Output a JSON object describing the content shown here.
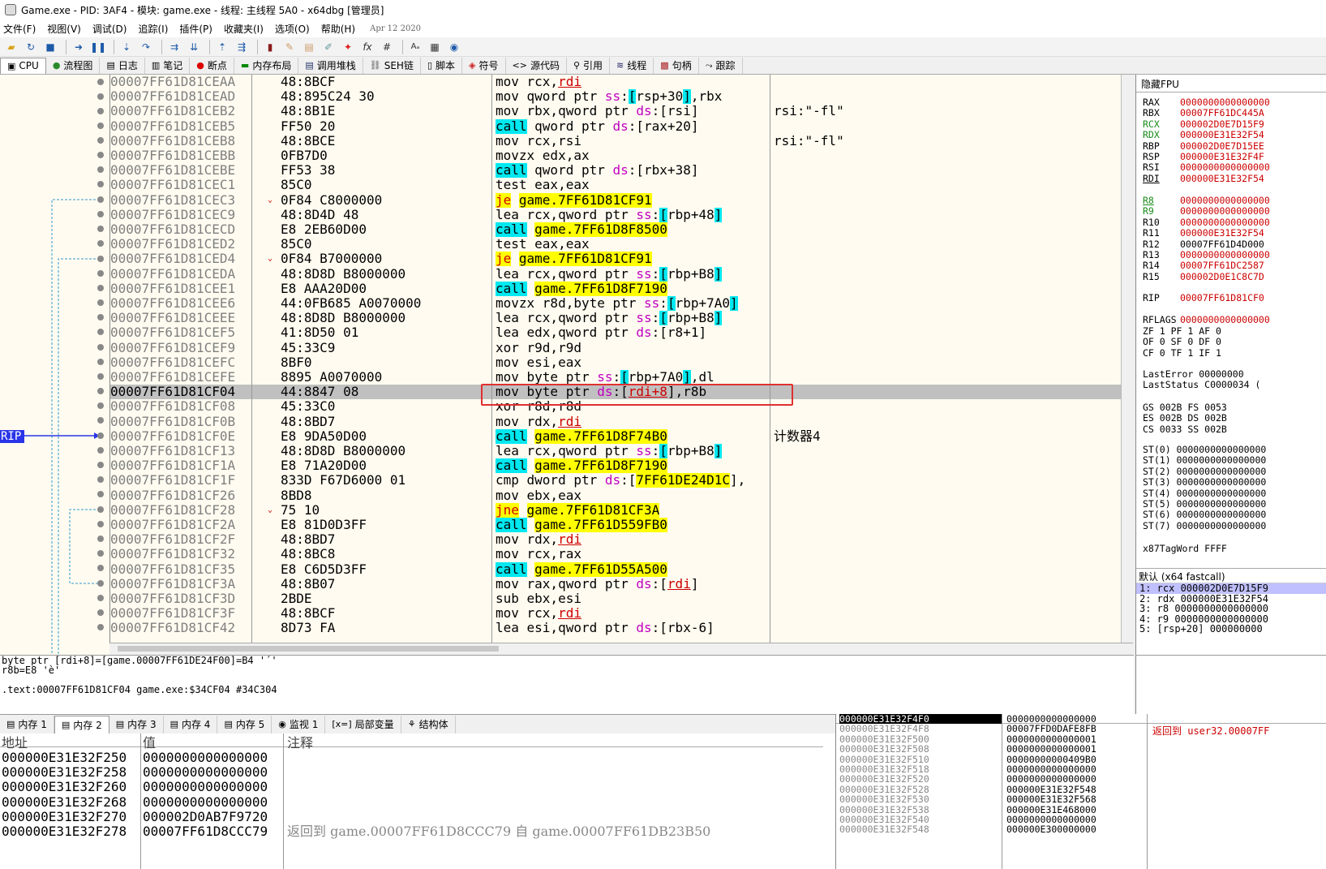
{
  "window": {
    "title": "Game.exe - PID: 3AF4 - 模块: game.exe - 线程: 主线程 5A0 - x64dbg [管理员]"
  },
  "menu": {
    "items": [
      "文件(F)",
      "视图(V)",
      "调试(D)",
      "追踪(I)",
      "插件(P)",
      "收藏夹(I)",
      "选项(O)",
      "帮助(H)"
    ],
    "date": "Apr 12 2020"
  },
  "toolbar": {
    "icons": [
      "open-icon",
      "restart-icon",
      "stop-icon",
      "run-icon",
      "pause-icon",
      "step-into-icon",
      "step-over-icon",
      "trace-into-icon",
      "trace-over-icon",
      "execute-till-return-icon",
      "run-to-user-code-icon",
      "patch-icon",
      "comment-icon",
      "label-icon",
      "bookmark-icon",
      "function-icon",
      "hash-icon",
      "font-icon",
      "calculator-icon",
      "module-icon",
      "globe-icon"
    ]
  },
  "tabs": [
    {
      "label": "CPU",
      "icon": "cpu-icon"
    },
    {
      "label": "流程图",
      "icon": "graph-icon"
    },
    {
      "label": "日志",
      "icon": "log-icon"
    },
    {
      "label": "笔记",
      "icon": "notes-icon"
    },
    {
      "label": "断点",
      "icon": "breakpoint-icon"
    },
    {
      "label": "内存布局",
      "icon": "memory-map-icon"
    },
    {
      "label": "调用堆栈",
      "icon": "callstack-icon"
    },
    {
      "label": "SEH链",
      "icon": "seh-icon"
    },
    {
      "label": "脚本",
      "icon": "script-icon"
    },
    {
      "label": "符号",
      "icon": "symbol-icon"
    },
    {
      "label": "源代码",
      "icon": "source-icon"
    },
    {
      "label": "引用",
      "icon": "references-icon"
    },
    {
      "label": "线程",
      "icon": "threads-icon"
    },
    {
      "label": "句柄",
      "icon": "handles-icon"
    },
    {
      "label": "跟踪",
      "icon": "trace-icon"
    }
  ],
  "rip_label": "RIP",
  "disasm": [
    {
      "addr": "00007FF61D81CEAA",
      "bytes": "48:8BCF",
      "i": [
        [
          "t",
          "mov rcx,"
        ],
        [
          "r",
          "rdi"
        ]
      ],
      "cmt": ""
    },
    {
      "addr": "00007FF61D81CEAD",
      "bytes": "48:895C24 30",
      "i": [
        [
          "t",
          "mov qword ptr "
        ],
        [
          "s",
          "ss"
        ],
        [
          "t",
          ":"
        ],
        [
          "b",
          "["
        ],
        [
          "t",
          "rsp+30"
        ],
        [
          "b",
          "]"
        ],
        [
          "t",
          ",rbx"
        ]
      ],
      "cmt": ""
    },
    {
      "addr": "00007FF61D81CEB2",
      "bytes": "48:8B1E",
      "i": [
        [
          "t",
          "mov rbx,qword ptr "
        ],
        [
          "s",
          "ds"
        ],
        [
          "t",
          ":[rsi]"
        ]
      ],
      "cmt": "rsi:\"-fl\""
    },
    {
      "addr": "00007FF61D81CEB5",
      "bytes": "FF50 20",
      "i": [
        [
          "c",
          "call"
        ],
        [
          "t",
          " qword ptr "
        ],
        [
          "s",
          "ds"
        ],
        [
          "t",
          ":[rax+20]"
        ]
      ],
      "cmt": ""
    },
    {
      "addr": "00007FF61D81CEB8",
      "bytes": "48:8BCE",
      "i": [
        [
          "t",
          "mov rcx,rsi"
        ]
      ],
      "cmt": "rsi:\"-fl\""
    },
    {
      "addr": "00007FF61D81CEBB",
      "bytes": "0FB7D0",
      "i": [
        [
          "t",
          "movzx edx,ax"
        ]
      ],
      "cmt": ""
    },
    {
      "addr": "00007FF61D81CEBE",
      "bytes": "FF53 38",
      "i": [
        [
          "c",
          "call"
        ],
        [
          "t",
          " qword ptr "
        ],
        [
          "s",
          "ds"
        ],
        [
          "t",
          ":[rbx+38]"
        ]
      ],
      "cmt": ""
    },
    {
      "addr": "00007FF61D81CEC1",
      "bytes": "85C0",
      "i": [
        [
          "t",
          "test eax,eax"
        ]
      ],
      "cmt": ""
    },
    {
      "addr": "00007FF61D81CEC3",
      "bytes": "0F84 C8000000",
      "arrow": true,
      "i": [
        [
          "j",
          "je"
        ],
        [
          "t",
          " "
        ],
        [
          "y",
          "game.7FF61D81CF91"
        ]
      ],
      "cmt": ""
    },
    {
      "addr": "00007FF61D81CEC9",
      "bytes": "48:8D4D 48",
      "i": [
        [
          "t",
          "lea rcx,qword ptr "
        ],
        [
          "s",
          "ss"
        ],
        [
          "t",
          ":"
        ],
        [
          "b",
          "["
        ],
        [
          "t",
          "rbp+48"
        ],
        [
          "b",
          "]"
        ]
      ],
      "cmt": ""
    },
    {
      "addr": "00007FF61D81CECD",
      "bytes": "E8 2EB60D00",
      "i": [
        [
          "c",
          "call"
        ],
        [
          "t",
          " "
        ],
        [
          "y",
          "game.7FF61D8F8500"
        ]
      ],
      "cmt": ""
    },
    {
      "addr": "00007FF61D81CED2",
      "bytes": "85C0",
      "i": [
        [
          "t",
          "test eax,eax"
        ]
      ],
      "cmt": ""
    },
    {
      "addr": "00007FF61D81CED4",
      "bytes": "0F84 B7000000",
      "arrow": true,
      "i": [
        [
          "j",
          "je"
        ],
        [
          "t",
          " "
        ],
        [
          "y",
          "game.7FF61D81CF91"
        ]
      ],
      "cmt": ""
    },
    {
      "addr": "00007FF61D81CEDA",
      "bytes": "48:8D8D B8000000",
      "i": [
        [
          "t",
          "lea rcx,qword ptr "
        ],
        [
          "s",
          "ss"
        ],
        [
          "t",
          ":"
        ],
        [
          "b",
          "["
        ],
        [
          "t",
          "rbp+B8"
        ],
        [
          "b",
          "]"
        ]
      ],
      "cmt": ""
    },
    {
      "addr": "00007FF61D81CEE1",
      "bytes": "E8 AAA20D00",
      "i": [
        [
          "c",
          "call"
        ],
        [
          "t",
          " "
        ],
        [
          "y",
          "game.7FF61D8F7190"
        ]
      ],
      "cmt": ""
    },
    {
      "addr": "00007FF61D81CEE6",
      "bytes": "44:0FB685 A0070000",
      "i": [
        [
          "t",
          "movzx r8d,byte ptr "
        ],
        [
          "s",
          "ss"
        ],
        [
          "t",
          ":"
        ],
        [
          "b",
          "["
        ],
        [
          "t",
          "rbp+7A0"
        ],
        [
          "b",
          "]"
        ]
      ],
      "cmt": ""
    },
    {
      "addr": "00007FF61D81CEEE",
      "bytes": "48:8D8D B8000000",
      "i": [
        [
          "t",
          "lea rcx,qword ptr "
        ],
        [
          "s",
          "ss"
        ],
        [
          "t",
          ":"
        ],
        [
          "b",
          "["
        ],
        [
          "t",
          "rbp+B8"
        ],
        [
          "b",
          "]"
        ]
      ],
      "cmt": ""
    },
    {
      "addr": "00007FF61D81CEF5",
      "bytes": "41:8D50 01",
      "i": [
        [
          "t",
          "lea edx,qword ptr "
        ],
        [
          "s",
          "ds"
        ],
        [
          "t",
          ":[r8+1]"
        ]
      ],
      "cmt": ""
    },
    {
      "addr": "00007FF61D81CEF9",
      "bytes": "45:33C9",
      "i": [
        [
          "t",
          "xor r9d,r9d"
        ]
      ],
      "cmt": ""
    },
    {
      "addr": "00007FF61D81CEFC",
      "bytes": "8BF0",
      "i": [
        [
          "t",
          "mov esi,eax"
        ]
      ],
      "cmt": ""
    },
    {
      "addr": "00007FF61D81CEFE",
      "bytes": "8895 A0070000",
      "i": [
        [
          "t",
          "mov byte ptr "
        ],
        [
          "s",
          "ss"
        ],
        [
          "t",
          ":"
        ],
        [
          "b",
          "["
        ],
        [
          "t",
          "rbp+7A0"
        ],
        [
          "b",
          "]"
        ],
        [
          "t",
          ",dl"
        ]
      ],
      "cmt": ""
    },
    {
      "addr": "00007FF61D81CF04",
      "bytes": "44:8847 08",
      "sel": true,
      "i": [
        [
          "t",
          "mov byte ptr "
        ],
        [
          "s",
          "ds"
        ],
        [
          "t",
          ":["
        ],
        [
          "r",
          "rdi+8"
        ],
        [
          "t",
          "],r8b"
        ]
      ],
      "cmt": ""
    },
    {
      "addr": "00007FF61D81CF08",
      "bytes": "45:33C0",
      "i": [
        [
          "t",
          "xor r8d,r8d"
        ]
      ],
      "cmt": ""
    },
    {
      "addr": "00007FF61D81CF0B",
      "bytes": "48:8BD7",
      "i": [
        [
          "t",
          "mov rdx,"
        ],
        [
          "r",
          "rdi"
        ]
      ],
      "cmt": ""
    },
    {
      "addr": "00007FF61D81CF0E",
      "bytes": "E8 9DA50D00",
      "i": [
        [
          "c",
          "call"
        ],
        [
          "t",
          " "
        ],
        [
          "y",
          "game.7FF61D8F74B0"
        ]
      ],
      "cmt": "计数器4"
    },
    {
      "addr": "00007FF61D81CF13",
      "bytes": "48:8D8D B8000000",
      "i": [
        [
          "t",
          "lea rcx,qword ptr "
        ],
        [
          "s",
          "ss"
        ],
        [
          "t",
          ":"
        ],
        [
          "b",
          "["
        ],
        [
          "t",
          "rbp+B8"
        ],
        [
          "b",
          "]"
        ]
      ],
      "cmt": ""
    },
    {
      "addr": "00007FF61D81CF1A",
      "bytes": "E8 71A20D00",
      "i": [
        [
          "c",
          "call"
        ],
        [
          "t",
          " "
        ],
        [
          "y",
          "game.7FF61D8F7190"
        ]
      ],
      "cmt": ""
    },
    {
      "addr": "00007FF61D81CF1F",
      "bytes": "833D F67D6000 01",
      "i": [
        [
          "t",
          "cmp dword ptr "
        ],
        [
          "s",
          "ds"
        ],
        [
          "t",
          ":["
        ],
        [
          "y",
          "7FF61DE24D1C"
        ],
        [
          "t",
          "],"
        ]
      ],
      "cmt": ""
    },
    {
      "addr": "00007FF61D81CF26",
      "bytes": "8BD8",
      "i": [
        [
          "t",
          "mov ebx,eax"
        ]
      ],
      "cmt": ""
    },
    {
      "addr": "00007FF61D81CF28",
      "bytes": "75 10",
      "arrow": true,
      "i": [
        [
          "j",
          "jne"
        ],
        [
          "t",
          " "
        ],
        [
          "y",
          "game.7FF61D81CF3A"
        ]
      ],
      "cmt": ""
    },
    {
      "addr": "00007FF61D81CF2A",
      "bytes": "E8 81D0D3FF",
      "i": [
        [
          "c",
          "call"
        ],
        [
          "t",
          " "
        ],
        [
          "y",
          "game.7FF61D559FB0"
        ]
      ],
      "cmt": ""
    },
    {
      "addr": "00007FF61D81CF2F",
      "bytes": "48:8BD7",
      "i": [
        [
          "t",
          "mov rdx,"
        ],
        [
          "r",
          "rdi"
        ]
      ],
      "cmt": ""
    },
    {
      "addr": "00007FF61D81CF32",
      "bytes": "48:8BC8",
      "i": [
        [
          "t",
          "mov rcx,rax"
        ]
      ],
      "cmt": ""
    },
    {
      "addr": "00007FF61D81CF35",
      "bytes": "E8 C6D5D3FF",
      "i": [
        [
          "c",
          "call"
        ],
        [
          "t",
          " "
        ],
        [
          "y",
          "game.7FF61D55A500"
        ]
      ],
      "cmt": ""
    },
    {
      "addr": "00007FF61D81CF3A",
      "bytes": "48:8B07",
      "i": [
        [
          "t",
          "mov rax,qword ptr "
        ],
        [
          "s",
          "ds"
        ],
        [
          "t",
          ":["
        ],
        [
          "r",
          "rdi"
        ],
        [
          "t",
          "]"
        ]
      ],
      "cmt": ""
    },
    {
      "addr": "00007FF61D81CF3D",
      "bytes": "2BDE",
      "i": [
        [
          "t",
          "sub ebx,esi"
        ]
      ],
      "cmt": ""
    },
    {
      "addr": "00007FF61D81CF3F",
      "bytes": "48:8BCF",
      "i": [
        [
          "t",
          "mov rcx,"
        ],
        [
          "r",
          "rdi"
        ]
      ],
      "cmt": ""
    },
    {
      "addr": "00007FF61D81CF42",
      "bytes": "8D73 FA",
      "i": [
        [
          "t",
          "lea esi,qword ptr "
        ],
        [
          "s",
          "ds"
        ],
        [
          "t",
          ":[rbx-6]"
        ]
      ],
      "cmt": ""
    }
  ],
  "registers": {
    "header": "隐藏FPU",
    "gp": [
      {
        "name": "RAX",
        "value": "0000000000000000"
      },
      {
        "name": "RBX",
        "value": "00007FF61DC445A"
      },
      {
        "name": "RCX",
        "value": "000002D0E7D15F9",
        "green": true
      },
      {
        "name": "RDX",
        "value": "000000E31E32F54",
        "green": true
      },
      {
        "name": "RBP",
        "value": "000002D0E7D15EE"
      },
      {
        "name": "RSP",
        "value": "000000E31E32F4F"
      },
      {
        "name": "RSI",
        "value": "0000000000000000"
      },
      {
        "name": "RDI",
        "value": "000000E31E32F54",
        "underline": true
      }
    ],
    "ext": [
      {
        "name": "R8",
        "value": "0000000000000000",
        "green": true,
        "underline": true
      },
      {
        "name": "R9",
        "value": "0000000000000000",
        "green": true
      },
      {
        "name": "R10",
        "value": "0000000000000000"
      },
      {
        "name": "R11",
        "value": "000000E31E32F54"
      },
      {
        "name": "R12",
        "value": "00007FF61D4D000",
        "dim": true
      },
      {
        "name": "R13",
        "value": "0000000000000000"
      },
      {
        "name": "R14",
        "value": "00007FF61DC2587"
      },
      {
        "name": "R15",
        "value": "000002D0E1C8C7D"
      }
    ],
    "rip": {
      "name": "RIP",
      "value": "00007FF61D81CF0"
    },
    "rflags": {
      "name": "RFLAGS",
      "value": "0000000000000000"
    },
    "flags": [
      "ZF 1   PF 1   AF 0",
      "OF 0   SF 0   DF 0",
      "CF 0   TF 1   IF 1"
    ],
    "last": [
      "LastError   00000000",
      "LastStatus C0000034  ("
    ],
    "seg": [
      "GS 002B  FS 0053",
      "ES 002B  DS 002B",
      "CS 0033  SS 002B"
    ],
    "fpu": [
      "ST(0) 0000000000000000",
      "ST(1) 0000000000000000",
      "ST(2) 0000000000000000",
      "ST(3) 0000000000000000",
      "ST(4) 0000000000000000",
      "ST(5) 0000000000000000",
      "ST(6) 0000000000000000",
      "ST(7) 0000000000000000"
    ],
    "tagword": "x87TagWord FFFF"
  },
  "callconv": {
    "header": "默认 (x64 fastcall)",
    "rows": [
      "1: rcx 000002D0E7D15F9",
      "2: rdx 000000E31E32F54",
      "3: r8 0000000000000000",
      "4: r9 0000000000000000",
      "5: [rsp+20] 000000000"
    ]
  },
  "info": {
    "lines": [
      "byte ptr [rdi+8]=[game.00007FF61DE24F00]=B4 '´'",
      "r8b=E8 'è'",
      "",
      ".text:00007FF61D81CF04 game.exe:$34CF04 #34C304"
    ]
  },
  "dumptabs": [
    {
      "label": "内存 1",
      "icon": "memory-icon"
    },
    {
      "label": "内存 2",
      "icon": "memory-icon"
    },
    {
      "label": "内存 3",
      "icon": "memory-icon"
    },
    {
      "label": "内存 4",
      "icon": "memory-icon"
    },
    {
      "label": "内存 5",
      "icon": "memory-icon"
    },
    {
      "label": "监视 1",
      "icon": "watch-icon"
    },
    {
      "label": "局部变量",
      "icon": "locals-icon"
    },
    {
      "label": "结构体",
      "icon": "struct-icon"
    }
  ],
  "dump": {
    "headers": {
      "addr": "地址",
      "value": "值",
      "comment": "注释"
    },
    "rows": [
      {
        "addr": "000000E31E32F250",
        "value": "0000000000000000",
        "comment": ""
      },
      {
        "addr": "000000E31E32F258",
        "value": "0000000000000000",
        "comment": ""
      },
      {
        "addr": "000000E31E32F260",
        "value": "0000000000000000",
        "comment": ""
      },
      {
        "addr": "000000E31E32F268",
        "value": "0000000000000000",
        "comment": ""
      },
      {
        "addr": "000000E31E32F270",
        "value": "000002D0AB7F9720",
        "comment": ""
      },
      {
        "addr": "000000E31E32F278",
        "value": "00007FF61D8CCC79",
        "comment": "返回到 game.00007FF61D8CCC79 自 game.00007FF61DB23B50"
      }
    ]
  },
  "stack": {
    "rows": [
      {
        "addr": "000000E31E32F4F0",
        "value": "0000000000000000",
        "sel": true
      },
      {
        "addr": "000000E31E32F4F8",
        "value": "00007FFD0DAFE8FB"
      },
      {
        "addr": "000000E31E32F500",
        "value": "0000000000000001"
      },
      {
        "addr": "000000E31E32F508",
        "value": "0000000000000001"
      },
      {
        "addr": "000000E31E32F510",
        "value": "00000000000409B0"
      },
      {
        "addr": "000000E31E32F518",
        "value": "0000000000000000"
      },
      {
        "addr": "000000E31E32F520",
        "value": "0000000000000000"
      },
      {
        "addr": "000000E31E32F528",
        "value": "000000E31E32F548"
      },
      {
        "addr": "000000E31E32F530",
        "value": "000000E31E32F568"
      },
      {
        "addr": "000000E31E32F538",
        "value": "000000E31E468000"
      },
      {
        "addr": "000000E31E32F540",
        "value": "0000000000000000"
      },
      {
        "addr": "000000E31E32F548",
        "value": "000000E300000000"
      }
    ],
    "comment": "返回到 user32.00007FF"
  }
}
